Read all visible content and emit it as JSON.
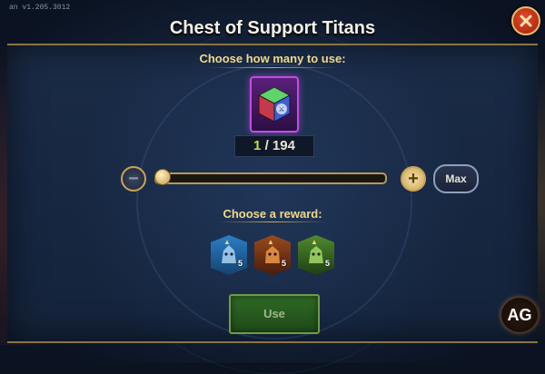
{
  "version": "an v1.205.3012",
  "dialog": {
    "title": "Chest of Support Titans",
    "choose_count_label": "Choose how many to use:",
    "item_icon": "chest-icon",
    "counter": {
      "current": "1",
      "separator": "/",
      "total": "194"
    },
    "slider": {
      "value": 1,
      "min": 1,
      "max": 194
    },
    "minus_label": "−",
    "plus_label": "+",
    "max_label": "Max",
    "choose_reward_label": "Choose a reward:",
    "rewards": [
      {
        "name": "titan-ice",
        "stars": "5",
        "color": "#2c7fc7"
      },
      {
        "name": "titan-fire",
        "stars": "5",
        "color": "#9a4a1e"
      },
      {
        "name": "titan-earth",
        "stars": "5",
        "color": "#4f8a2e"
      }
    ],
    "use_label": "Use",
    "close_icon": "close-icon"
  },
  "logo_text": "AG",
  "colors": {
    "accent_gold": "#c9a457",
    "close_red": "#c72f18",
    "use_green": "#2f6a25",
    "subheading": "#f0d98a"
  }
}
